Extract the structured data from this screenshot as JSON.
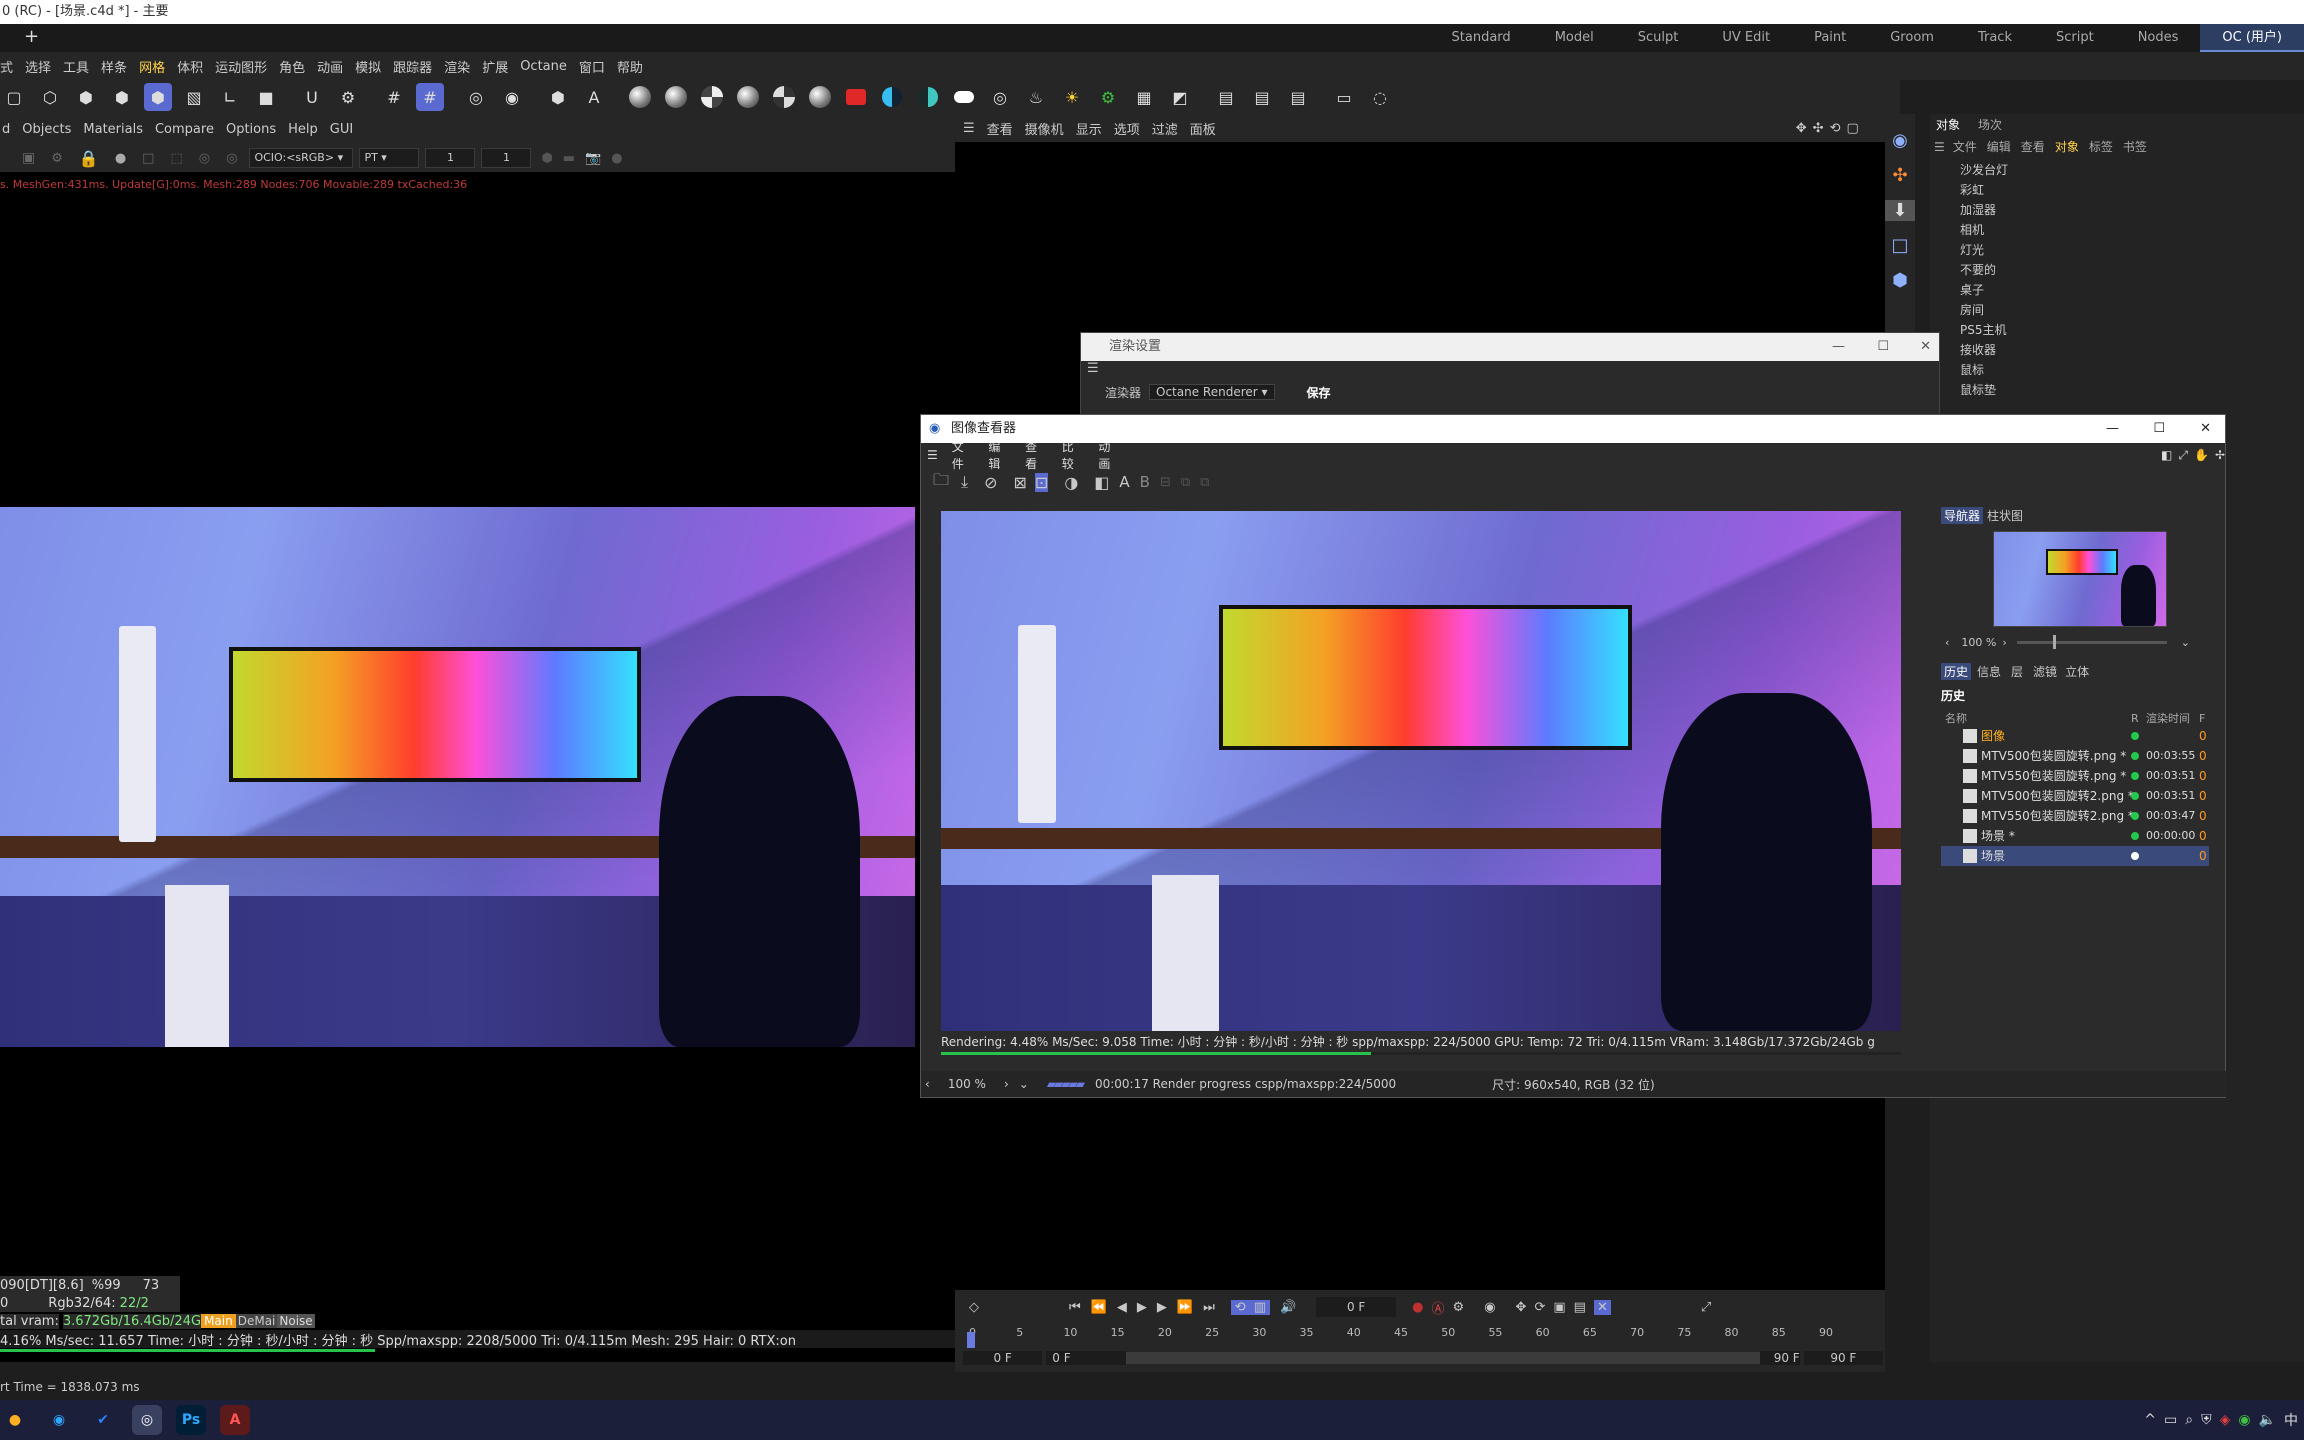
{
  "window": {
    "title": "0 (RC) - [场景.c4d *] - 主要"
  },
  "layouts": [
    "Standard",
    "Model",
    "Sculpt",
    "UV Edit",
    "Paint",
    "Groom",
    "Track",
    "Script",
    "Nodes",
    "OC (用户)"
  ],
  "menu": [
    "式",
    "选择",
    "工具",
    "样条",
    "网格",
    "体积",
    "运动图形",
    "角色",
    "动画",
    "模拟",
    "跟踪器",
    "渲染",
    "扩展",
    "Octane",
    "窗口",
    "帮助"
  ],
  "left_viewport": {
    "menu": [
      "d",
      "Objects",
      "Materials",
      "Compare",
      "Options",
      "Help",
      "GUI"
    ],
    "ocio": "OCIO:<sRGB>",
    "mode": "PT",
    "frame_a": "1",
    "frame_b": "1",
    "stats_line": "s. MeshGen:431ms. Update[G]:0ms. Mesh:289 Nodes:706 Movable:289 txCached:36",
    "overlay": {
      "line1_a": "090[DT][8.6]",
      "line1_b": "%99",
      "line1_c": "73",
      "line2_a": "0",
      "line2_b": "Rgb32/64:",
      "line2_c": "22/2",
      "line3_a": "tal vram:",
      "line3_b": "3.672Gb/16.4Gb/24G",
      "tab_main": "Main",
      "tab_demai": "DeMai",
      "tab_noise": "Noise",
      "line4": "4.16% Ms/sec: 11.657   Time: 小时 : 分钟 : 秒/小时 : 分钟 : 秒   Spp/maxspp: 2208/5000   Tri: 0/4.115m   Mesh: 295   Hair: 0   RTX:on"
    },
    "status": "rt Time = 1838.073 ms"
  },
  "right_viewport": {
    "menu": [
      "查看",
      "摄像机",
      "显示",
      "选项",
      "过滤",
      "面板"
    ]
  },
  "render_settings": {
    "title": "渲染设置",
    "renderer_label": "渲染器",
    "renderer_value": "Octane Renderer",
    "save_label": "保存"
  },
  "image_viewer": {
    "title": "图像查看器",
    "menu": [
      "文件",
      "编辑",
      "查看",
      "比较",
      "动画"
    ],
    "tool_a": "A",
    "tool_b": "B",
    "stats": "Rendering: 4.48%   Ms/Sec: 9.058   Time: 小时 : 分钟 : 秒/小时 : 分钟 : 秒   spp/maxspp: 224/5000   GPU:    Temp: 72   Tri: 0/4.115m   VRam: 3.148Gb/17.372Gb/24Gb   g",
    "zoom": "100 %",
    "progress_text": "00:00:17 Render progress  cspp/maxspp:224/5000",
    "size_text": "尺寸: 960x540, RGB (32 位)",
    "progress": 0.0448,
    "right_tabs_top": [
      "导航器",
      "柱状图"
    ],
    "nav_zoom": "100 %",
    "right_tabs": [
      "历史",
      "信息",
      "层",
      "滤镜",
      "立体"
    ],
    "history_title": "历史",
    "history_cols": [
      "名称",
      "R",
      "渲染时间",
      "F"
    ],
    "history": [
      {
        "name": "图像",
        "time": "",
        "f": "0",
        "color": "#ffb020"
      },
      {
        "name": "MTV500包装圆旋转.png *",
        "time": "00:03:55",
        "f": "0",
        "color": "#ddd"
      },
      {
        "name": "MTV550包装圆旋转.png *",
        "time": "00:03:51",
        "f": "0",
        "color": "#ddd"
      },
      {
        "name": "MTV500包装圆旋转2.png *",
        "time": "00:03:51",
        "f": "0",
        "color": "#ddd"
      },
      {
        "name": "MTV550包装圆旋转2.png *",
        "time": "00:03:47",
        "f": "0",
        "color": "#ddd"
      },
      {
        "name": "场景 *",
        "time": "00:00:00",
        "f": "0",
        "color": "#ddd"
      },
      {
        "name": "场景",
        "time": "",
        "f": "0",
        "color": "#ddd"
      }
    ]
  },
  "object_manager": {
    "tabs": [
      "对象",
      "场次"
    ],
    "menu": [
      "文件",
      "编辑",
      "查看",
      "对象",
      "标签",
      "书签"
    ],
    "objects": [
      "沙发台灯",
      "彩虹",
      "加湿器",
      "相机",
      "灯光",
      "不要的",
      "桌子",
      "房间",
      "PS5主机",
      "接收器",
      "鼠标",
      "鼠标垫"
    ]
  },
  "timeline": {
    "frame_field": "0 F",
    "ruler": [
      "0",
      "5",
      "10",
      "15",
      "20",
      "25",
      "30",
      "35",
      "40",
      "45",
      "50",
      "55",
      "60",
      "65",
      "70",
      "75",
      "80",
      "85",
      "90"
    ],
    "start": "0 F",
    "start2": "0 F",
    "end": "90 F",
    "end2": "90 F"
  },
  "taskbar": {
    "ps_label": "Ps",
    "acrobat_label": "A"
  }
}
